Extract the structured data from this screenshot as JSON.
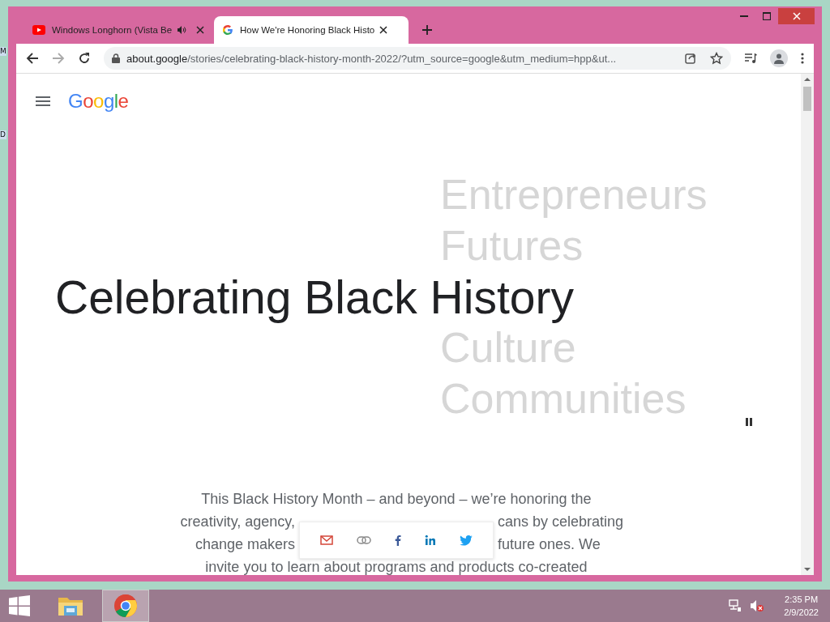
{
  "desktop_labels": [
    "M",
    "D"
  ],
  "tabs": [
    {
      "title": "Windows Longhorn (Vista Be",
      "kind": "video",
      "audio": true,
      "selected": false
    },
    {
      "title": "How We're Honoring Black Histo",
      "kind": "google",
      "audio": false,
      "selected": true
    }
  ],
  "address": {
    "host": "about.google",
    "path": "/stories/celebrating-black-history-month-2022/?utm_source=google&utm_medium=hpp&ut..."
  },
  "page": {
    "logo": "Google",
    "rotating_words": [
      "Entrepreneurs",
      "Futures",
      "Culture",
      "Communities"
    ],
    "headline": "Celebrating Black History",
    "paragraph_lines": [
      [
        "This Black History Month – and beyond – we’re honoring the"
      ],
      [
        "creativity, agency,",
        "cans by celebrating"
      ],
      [
        "change makers",
        "future ones. We"
      ],
      [
        "invite you to learn about programs and products co-created"
      ]
    ]
  },
  "taskbar": {
    "time": "2:35 PM",
    "date": "2/9/2022"
  }
}
